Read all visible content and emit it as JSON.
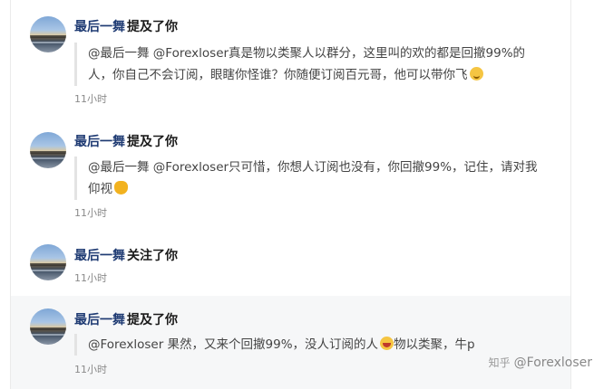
{
  "notifications": [
    {
      "user": "最后一舞",
      "action": "提及了你",
      "quote_parts": [
        "@最后一舞 @Forexloser真是物以类聚人以群分，这里叫的欢的都是回撤99%的人，你自己不会订阅，眼瞎你怪谁？你随便订阅百元哥，他可以带你飞"
      ],
      "emoji": "slightly-smiling-face-icon",
      "time": "11小时"
    },
    {
      "user": "最后一舞",
      "action": "提及了你",
      "quote_parts": [
        "@最后一舞 @Forexloser只可惜，你想人订阅也没有，你回撤99%，记住，请对我仰视"
      ],
      "emoji": "clapping-hands-icon",
      "time": "11小时"
    },
    {
      "user": "最后一舞",
      "action": "关注了你",
      "time": "11小时"
    },
    {
      "user": "最后一舞",
      "action": "提及了你",
      "quote_parts": [
        "@Forexloser 果然，又来个回撤99%，没人订阅的人",
        "物以类聚，牛p"
      ],
      "emoji": "laughing-face-icon",
      "time": "11小时"
    }
  ],
  "watermark": {
    "logo": "知乎",
    "text": "@Forexloser"
  }
}
